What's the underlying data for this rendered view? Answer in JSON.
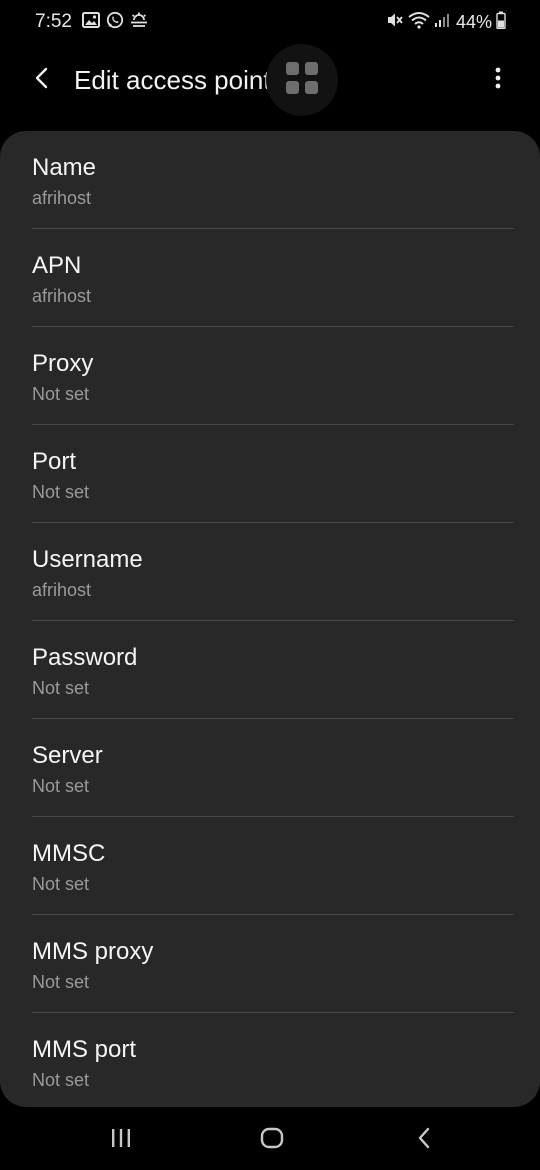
{
  "status_bar": {
    "time": "7:52",
    "battery": "44%",
    "left_icons": [
      "gallery-icon",
      "whatsapp-icon",
      "weather-icon"
    ],
    "right_icons": [
      "mute-icon",
      "wifi-icon",
      "signal-icon",
      "battery-icon"
    ]
  },
  "app_bar": {
    "title": "Edit access point",
    "back_icon": "back-arrow-icon",
    "more_icon": "more-vert-icon",
    "floating_icon": "apps-grid-icon"
  },
  "fields": [
    {
      "title": "Name",
      "value": "afrihost"
    },
    {
      "title": "APN",
      "value": "afrihost"
    },
    {
      "title": "Proxy",
      "value": "Not set"
    },
    {
      "title": "Port",
      "value": "Not set"
    },
    {
      "title": "Username",
      "value": "afrihost"
    },
    {
      "title": "Password",
      "value": "Not set"
    },
    {
      "title": "Server",
      "value": "Not set"
    },
    {
      "title": "MMSC",
      "value": "Not set"
    },
    {
      "title": "MMS proxy",
      "value": "Not set"
    },
    {
      "title": "MMS port",
      "value": "Not set"
    }
  ],
  "nav_bar": {
    "recents_icon": "recents-icon",
    "home_icon": "home-icon",
    "back_icon": "nav-back-icon"
  },
  "colors": {
    "background": "#000000",
    "card": "#282828",
    "title_text": "#f5f5f5",
    "value_text": "#9a9a9a",
    "divider": "#474747"
  }
}
